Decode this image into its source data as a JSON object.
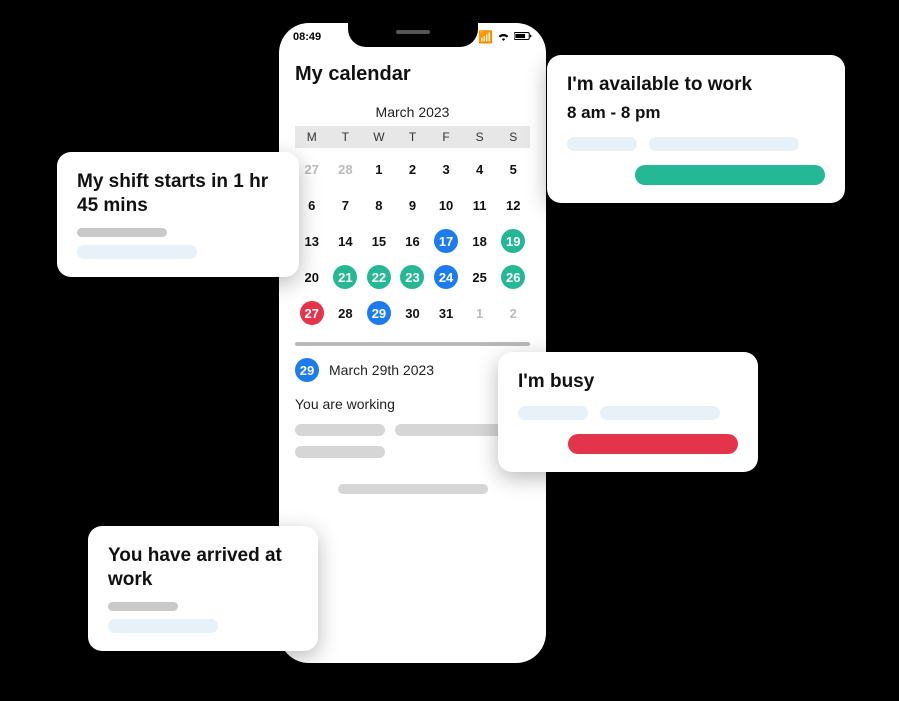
{
  "status": {
    "time": "08:49"
  },
  "title": "My calendar",
  "calendar": {
    "month_label": "March 2023",
    "dow": [
      "M",
      "T",
      "W",
      "T",
      "F",
      "S",
      "S"
    ],
    "cells": [
      {
        "n": "27",
        "dim": true
      },
      {
        "n": "28",
        "dim": true
      },
      {
        "n": "1"
      },
      {
        "n": "2"
      },
      {
        "n": "3"
      },
      {
        "n": "4"
      },
      {
        "n": "5"
      },
      {
        "n": "6"
      },
      {
        "n": "7"
      },
      {
        "n": "8"
      },
      {
        "n": "9"
      },
      {
        "n": "10"
      },
      {
        "n": "11"
      },
      {
        "n": "12"
      },
      {
        "n": "13"
      },
      {
        "n": "14"
      },
      {
        "n": "15"
      },
      {
        "n": "16"
      },
      {
        "n": "17",
        "c": "blue"
      },
      {
        "n": "18"
      },
      {
        "n": "19",
        "c": "green"
      },
      {
        "n": "20"
      },
      {
        "n": "21",
        "c": "green"
      },
      {
        "n": "22",
        "c": "green"
      },
      {
        "n": "23",
        "c": "green"
      },
      {
        "n": "24",
        "c": "blue"
      },
      {
        "n": "25"
      },
      {
        "n": "26",
        "c": "green"
      },
      {
        "n": "27",
        "c": "red"
      },
      {
        "n": "28"
      },
      {
        "n": "29",
        "c": "blue"
      },
      {
        "n": "30"
      },
      {
        "n": "31"
      },
      {
        "n": "1",
        "dim": true
      },
      {
        "n": "2",
        "dim": true
      }
    ],
    "selected_day": "29",
    "selected_date_label": "March 29th 2023",
    "working_label": "You are working"
  },
  "cards": {
    "shift": {
      "title": "My shift starts in 1 hr 45 mins"
    },
    "available": {
      "title": "I'm available to work",
      "sub": "8 am - 8 pm"
    },
    "busy": {
      "title": "I'm busy"
    },
    "arrived": {
      "title": "You have arrived at work"
    }
  }
}
